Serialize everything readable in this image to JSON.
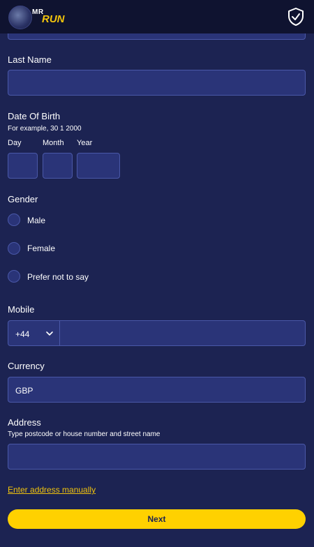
{
  "header": {
    "logo_top": "MR",
    "logo_main": "RUN",
    "shield_icon": "shield-check-icon"
  },
  "form": {
    "last_name": {
      "label": "Last Name",
      "value": ""
    },
    "dob": {
      "label": "Date Of Birth",
      "hint": "For example, 30 1 2000",
      "day_label": "Day",
      "month_label": "Month",
      "year_label": "Year"
    },
    "gender": {
      "label": "Gender",
      "options": [
        "Male",
        "Female",
        "Prefer not to say"
      ]
    },
    "mobile": {
      "label": "Mobile",
      "prefix": "+44",
      "number": ""
    },
    "currency": {
      "label": "Currency",
      "value": "GBP"
    },
    "address": {
      "label": "Address",
      "hint": "Type postcode or house number and street name",
      "value": ""
    },
    "manual_link": "Enter address manually",
    "next_label": "Next"
  },
  "colors": {
    "background": "#1c2352",
    "field": "#2a3478",
    "accent": "#ffd100"
  }
}
